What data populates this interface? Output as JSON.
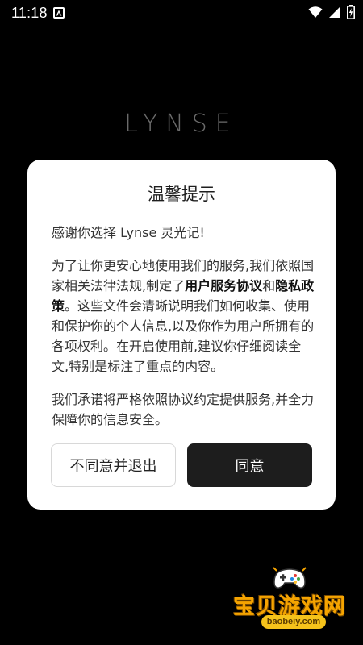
{
  "status_bar": {
    "time": "11:18",
    "icons": [
      "notification-a-icon",
      "wifi-icon",
      "signal-icon",
      "battery-charging-icon"
    ]
  },
  "background": {
    "logo_text": "LYNSE",
    "logo_color": "#6b6b6b"
  },
  "dialog": {
    "title": "温馨提示",
    "intro": "感谢你选择 Lynse 灵光记!",
    "paragraph2_pre": "为了让你更安心地使用我们的服务,我们依照国家相关法律法规,制定了",
    "link_terms": "用户服务协议",
    "paragraph2_and": "和",
    "link_privacy": "隐私政策",
    "paragraph2_post": "。这些文件会清晰说明我们如何收集、使用和保护你的个人信息,以及你作为用户所拥有的各项权利。在开启使用前,建议你仔细阅读全文,特别是标注了重点的内容。",
    "paragraph3": "我们承诺将严格依照协议约定提供服务,并全力保障你的信息安全。",
    "disagree_button": "不同意并退出",
    "agree_button": "同意"
  },
  "watermark": {
    "text": "宝贝游戏网",
    "url": "baobeiy.com"
  },
  "colors": {
    "background": "#000000",
    "dialog": "#ffffff",
    "agree_button": "#1d1d1d",
    "watermark": "#f5a400"
  }
}
